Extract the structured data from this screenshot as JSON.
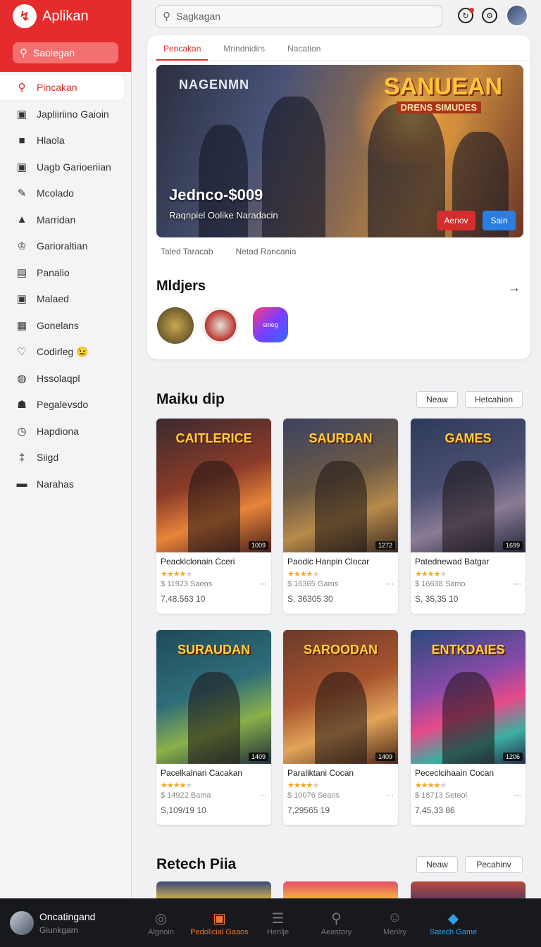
{
  "app": {
    "title": "Aplikan"
  },
  "sidebar": {
    "search_label": "Saolegan",
    "items": [
      {
        "label": "Pincakan",
        "icon": "search-icon",
        "glyph": "⚲",
        "active": true
      },
      {
        "label": "Japliiriino Gaioin",
        "icon": "window-icon",
        "glyph": "▣"
      },
      {
        "label": "Hlaola",
        "icon": "square-icon",
        "glyph": "■"
      },
      {
        "label": "Uagb Garioeriian",
        "icon": "window-icon",
        "glyph": "▣"
      },
      {
        "label": "Mcolado",
        "icon": "brush-icon",
        "glyph": "✎"
      },
      {
        "label": "Marridan",
        "icon": "figure-icon",
        "glyph": "▲"
      },
      {
        "label": "Garioraltian",
        "icon": "crown-icon",
        "glyph": "♔"
      },
      {
        "label": "Panalio",
        "icon": "briefcase-icon",
        "glyph": "▤"
      },
      {
        "label": "Malaed",
        "icon": "image-icon",
        "glyph": "▣"
      },
      {
        "label": "Gonelans",
        "icon": "gallery-icon",
        "glyph": "▦"
      },
      {
        "label": "Codirleg 😉",
        "icon": "heart-icon",
        "glyph": "♡"
      },
      {
        "label": "Hssolaqpl",
        "icon": "grid-circle-icon",
        "glyph": "◍"
      },
      {
        "label": "Pegalevsdo",
        "icon": "user-group-icon",
        "glyph": "☗"
      },
      {
        "label": "Hapdiona",
        "icon": "clock-icon",
        "glyph": "◷"
      },
      {
        "label": "Siigd",
        "icon": "signpost-icon",
        "glyph": "‡"
      },
      {
        "label": "Narahas",
        "icon": "folder-icon",
        "glyph": "▬"
      }
    ]
  },
  "topbar": {
    "search_placeholder": "Sagkagan"
  },
  "featured": {
    "tabs": [
      "Pencakan",
      "Mrindnidirs",
      "Nacation"
    ],
    "hero_title_left": "NAGENMN",
    "hero_title_right": "SANUEAN",
    "hero_sub_right": "DRENS SIMUDES",
    "hero_price": "Jednco-$009",
    "hero_desc": "Raqnpiel Oolike Naradacin",
    "btn_red": "Aenov",
    "btn_blue": "Sain",
    "links": [
      "Taled Taracab",
      "Netad Rancania"
    ],
    "section_title": "Mldjers",
    "mini_c_label": "snieg"
  },
  "section1": {
    "title": "Maiku dip",
    "chip1": "Neaw",
    "chip2": "Hetcahion"
  },
  "section2": {
    "title": "Retech Piia",
    "chip1": "Neaw",
    "chip2": "Pecahinv"
  },
  "cards": [
    {
      "art": "CAITLERICE",
      "badge": "1009",
      "name": "Peacklclonain Cceri",
      "stars": 4,
      "meta": "$  11923 Saens",
      "price": "7,48,563  10",
      "bg": "linear-gradient(160deg,#3a2a30,#8a3b28 45%,#e7843a 70%,#4a1f1c)"
    },
    {
      "art": "SAURDAN",
      "badge": "1272",
      "name": "Paodic Hanpin Clocar",
      "stars": 4,
      "meta": "$  16365 Gams",
      "price": "S, 36305  30",
      "bg": "linear-gradient(160deg,#3b4260,#6c5a45 45%,#b68a4a 70%,#3b2b22)"
    },
    {
      "art": "GAMES",
      "badge": "1699",
      "name": "Patednewad Batgar",
      "stars": 4,
      "meta": "$  16638 Samo",
      "price": "S, 35,35  10",
      "bg": "linear-gradient(160deg,#2e3a5a,#4a4f72 45%,#8a7b95 70%,#24263a)"
    },
    {
      "art": "SURAUDAN",
      "badge": "1409",
      "name": "Pacelkalnari Cacakan",
      "stars": 4,
      "meta": "$  14922 Bama",
      "price": "S,109/19  10",
      "bg": "linear-gradient(160deg,#1f4a5a,#2f6d7a 45%,#8ab04a 70%,#1e2f3a)"
    },
    {
      "art": "SAROODAN",
      "badge": "1409",
      "name": "Paraliktani Cocan",
      "stars": 4,
      "meta": "$  10076 Seans",
      "price": "7,29565  19",
      "bg": "linear-gradient(160deg,#6a3a2a,#a8542e 45%,#e2a45a 70%,#4a2418)"
    },
    {
      "art": "ENTKDAIES",
      "badge": "1206",
      "name": "Pececlcihaain Cocan",
      "stars": 4,
      "meta": "$  18713 Seteol",
      "price": "7,45,33  86",
      "bg": "linear-gradient(160deg,#2a4a7a,#8a4aa8 40%,#e64a8a 60%,#3ab0a0 80%,#242a4a)"
    }
  ],
  "bottom": {
    "user_name": "Oncatingand",
    "user_sub": "Giunkgam",
    "nav": [
      {
        "label": "Algnoin",
        "icon": "compass-icon",
        "glyph": "◎",
        "style": ""
      },
      {
        "label": "Pedolicial Gaaos",
        "icon": "store-icon",
        "glyph": "▣",
        "style": "orange"
      },
      {
        "label": "Henlje",
        "icon": "menu-icon",
        "glyph": "☰",
        "style": ""
      },
      {
        "label": "Aeastory",
        "icon": "search-icon",
        "glyph": "⚲",
        "style": ""
      },
      {
        "label": "Menlry",
        "icon": "people-icon",
        "glyph": "☺",
        "style": ""
      },
      {
        "label": "Satech Game",
        "icon": "bag-icon",
        "glyph": "◆",
        "style": "blue"
      }
    ]
  },
  "colors": {
    "accent": "#e52b2b",
    "active_nav": "#e8752c",
    "link_nav": "#2aa0e8"
  }
}
